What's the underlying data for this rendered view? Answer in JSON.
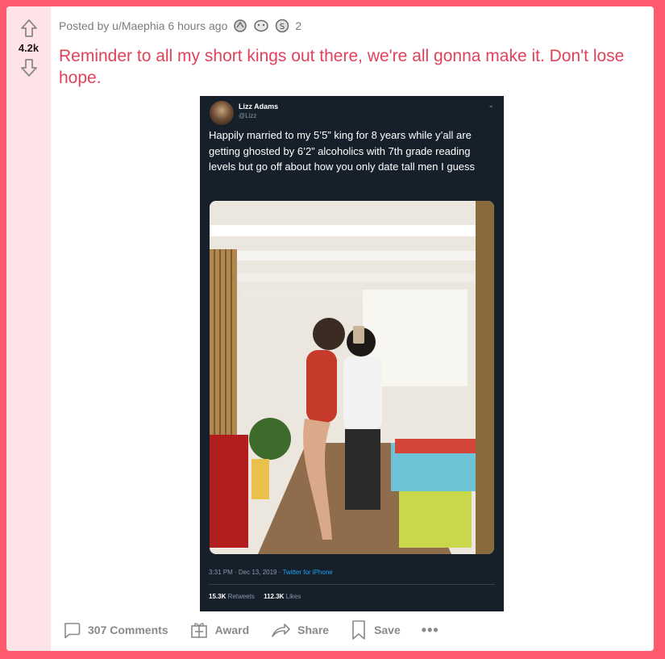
{
  "post": {
    "score": "4.2k",
    "posted_by": "Posted by u/Maephia 6 hours ago",
    "award_count": "2",
    "title": "Reminder to all my short kings out there, we're all gonna make it. Don't lose hope.",
    "colors": {
      "title": "#e0425a",
      "frame": "#ff5a6e",
      "vote_bg": "#ffe3e6"
    }
  },
  "tweet": {
    "name": "Lizz Adams",
    "handle": "@Lizz",
    "text": "Happily married to my 5’5” king for 8 years while y’all are getting ghosted by 6’2” alcoholics with 7th grade reading levels but go off about how you only date tall men I guess",
    "time": "3:31 PM · Dec 13, 2019 · ",
    "source": "Twitter for iPhone",
    "retweets": "15.3K",
    "retweets_label": " Retweets",
    "likes": "112.3K",
    "likes_label": " Likes"
  },
  "actions": {
    "comments": "307 Comments",
    "award": "Award",
    "share": "Share",
    "save": "Save",
    "more": "•••"
  }
}
